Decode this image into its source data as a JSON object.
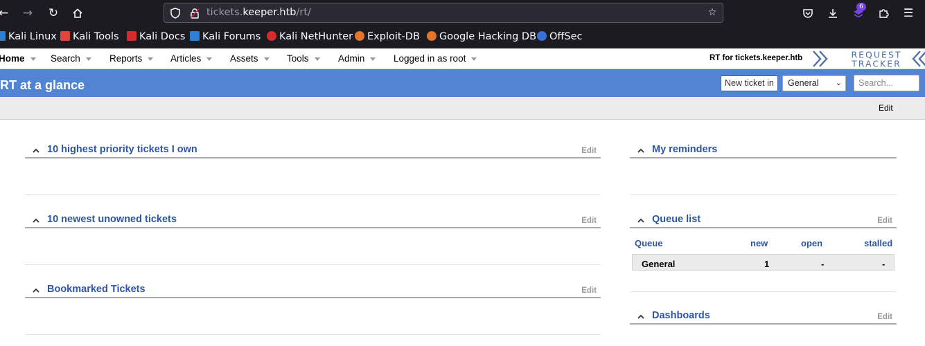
{
  "browser": {
    "url_prefix": "tickets.",
    "url_host": "keeper.htb",
    "url_path": "/rt/",
    "extension_badge": "6"
  },
  "bookmarks": [
    {
      "label": "Kali Linux",
      "icon_color": "#2f7fd3"
    },
    {
      "label": "Kali Tools",
      "icon_color": "#e0443f"
    },
    {
      "label": "Kali Docs",
      "icon_color": "#d42c2c"
    },
    {
      "label": "Kali Forums",
      "icon_color": "#2f7fd3"
    },
    {
      "label": "Kali NetHunter",
      "icon_color": "#d42c2c"
    },
    {
      "label": "Exploit-DB",
      "icon_color": "#e5752a"
    },
    {
      "label": "Google Hacking DB",
      "icon_color": "#e5752a"
    },
    {
      "label": "OffSec",
      "icon_color": "#3b6fd8"
    }
  ],
  "menu": {
    "home": "Home",
    "search": "Search",
    "reports": "Reports",
    "articles": "Articles",
    "assets": "Assets",
    "tools": "Tools",
    "admin": "Admin",
    "logged_in": "Logged in as root",
    "rt_for": "RT for tickets.keeper.htb",
    "logo_line1": "REQUEST",
    "logo_line2": "TRACKER"
  },
  "title_bar": {
    "title": "RT at a glance",
    "new_ticket_label": "New ticket in",
    "queue_selected": "General",
    "search_placeholder": "Search..."
  },
  "page_edit_label": "Edit",
  "portlets": {
    "priority": {
      "title": "10 highest priority tickets I own",
      "edit": "Edit"
    },
    "newest": {
      "title": "10 newest unowned tickets",
      "edit": "Edit"
    },
    "bookmarked": {
      "title": "Bookmarked Tickets",
      "edit": "Edit"
    },
    "reminders": {
      "title": "My reminders"
    },
    "queue_list": {
      "title": "Queue list",
      "edit": "Edit",
      "headers": {
        "queue": "Queue",
        "new": "new",
        "open": "open",
        "stalled": "stalled"
      },
      "rows": [
        {
          "queue": "General",
          "new": "1",
          "open": "-",
          "stalled": "-"
        }
      ]
    },
    "dashboards": {
      "title": "Dashboards",
      "edit": "Edit"
    }
  },
  "colors": {
    "title_bar": "#5185d4",
    "link_blue": "#2d55a4",
    "browser_chrome": "#1c1b22"
  }
}
